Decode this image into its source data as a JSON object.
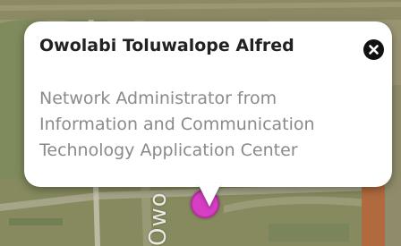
{
  "map": {
    "road_label": "Owo",
    "marker_color": "#d63fc4"
  },
  "popup": {
    "title": "Owolabi Toluwalope Alfred",
    "description": "Network Administrator from Information and Communication Technology Application Center",
    "close_icon": "close-icon"
  }
}
